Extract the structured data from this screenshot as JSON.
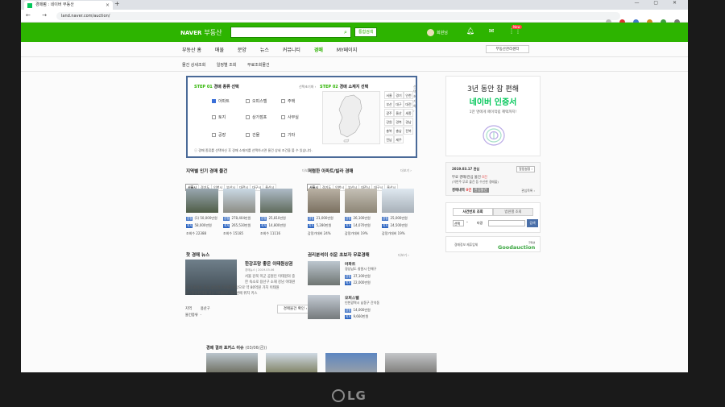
{
  "browser": {
    "tab_title": "경매펌 : 네이버 부동산",
    "new_tab": "+",
    "url": "land.naver.com/auction/",
    "window_controls": "— ▢ ✕"
  },
  "header": {
    "logo": "NAVER",
    "service": "부동산",
    "search_button_icon": "⌕",
    "integrated_search": "통합검색",
    "user_name": "회원님",
    "mail_badge": "New"
  },
  "gnb": {
    "items": [
      "부동산 홈",
      "매물",
      "분양",
      "뉴스",
      "커뮤니티",
      "경매",
      "MY페이지"
    ],
    "right_button": "부동산관리센터"
  },
  "lnb": {
    "items": [
      "물건 상세조회",
      "일정별 조회",
      "무료조회물건"
    ]
  },
  "step1": {
    "title_num": "STEP 01",
    "title": "경매 종류 선택",
    "reset": "선택초기화 ›",
    "options": [
      {
        "label": "아파트",
        "checked": true
      },
      {
        "label": "오피스텔",
        "checked": false
      },
      {
        "label": "주택",
        "checked": false
      },
      {
        "label": "토지",
        "checked": false
      },
      {
        "label": "상가점포",
        "checked": false
      },
      {
        "label": "사무실",
        "checked": false
      },
      {
        "label": "공장",
        "checked": false
      },
      {
        "label": "건물",
        "checked": false
      },
      {
        "label": "기타",
        "checked": false
      }
    ]
  },
  "step2": {
    "title_num": "STEP 02",
    "title": "경매 소재지 선택",
    "reset": "선택초기화 ›",
    "regions": [
      "서울",
      "경기",
      "인천",
      "부산",
      "대구",
      "대전",
      "광주",
      "울산",
      "세종",
      "강원",
      "경북",
      "경남",
      "충북",
      "충남",
      "전북",
      "전남",
      "제주"
    ]
  },
  "step_note": "경매 종류를 선택하신 후 경매 소재지를 선택하시면 물건 상세 조건을 볼 수 있습니다.",
  "popular": {
    "title": "지역별 인기 경매 물건",
    "more": "더보기 ›",
    "tabs": [
      "서울시",
      "경기도",
      "인천시",
      "부산시",
      "대전시",
      "대구시",
      "울산시"
    ],
    "items": [
      {
        "p1": "(1) 50,000만원",
        "p2": "58,000만원",
        "views": "조회수 22388"
      },
      {
        "p1": "278,404만원",
        "p2": "265,530만원",
        "views": "조회수 15185"
      },
      {
        "p1": "25,810만원",
        "p2": "14,800만원",
        "views": "조회수 11116"
      }
    ]
  },
  "cheap": {
    "title": "저렴한 아파트/빌라 경매",
    "more": "더보기 ›",
    "tabs": [
      "서울시",
      "경기도",
      "인천시",
      "부산시",
      "대전시",
      "대구시",
      "울산시"
    ],
    "items": [
      {
        "p1": "21,000만원",
        "p2": "5,280만원",
        "rate": "감정가대비 24%"
      },
      {
        "p1": "26,100만원",
        "p2": "14,070만원",
        "rate": "감정가대비 19%"
      },
      {
        "p1": "25,000만원",
        "p2": "24,500만원",
        "rate": "감정가대비 19%"
      }
    ]
  },
  "news": {
    "title": "핫 경매 뉴스",
    "headline": "한강조망 좋은 이태원상권",
    "sub": "경매뉴스 | 2019.03.06",
    "body1": "서울 강북 미군 공원인 이태원의 중",
    "body2": "한 숙소로 용산구 소재 강남 이태원",
    "body3": "여기 봉리는 중심 상업권 지위를 바탕으로 약 80억원 가치 이태원",
    "body4": "로~한강진역을 잇는 이태원로 대로변에 위치 키스",
    "loc_label": "지역",
    "loc_value": "용산구",
    "type_label": "물건종류",
    "type_value": "-",
    "button": "경매물건 확인 ›"
  },
  "recommend": {
    "title": "권리분석이 쉬운 초보자 무료경매",
    "more": "더보기 ›",
    "items": [
      {
        "name": "아파트",
        "addr": "경상남도 창원시 진해구",
        "p1": "37,100만원",
        "p2": "22,000만원"
      },
      {
        "name": "오피스텔",
        "addr": "인천광역시 남동구 간석동",
        "p1": "14,000만원",
        "p2": "9,660만원"
      }
    ]
  },
  "ad": {
    "line1": "3년 동안 참 편해",
    "line2": "네이버 인증서",
    "line3": "1만 명에게 페이적립 혜택까지!"
  },
  "info": {
    "title": "2019.03.17 관심",
    "button": "알림설정 ›",
    "msg1": "무료 경매/관심 물건",
    "msg1_count": "0건",
    "msg2": "(이번주 무료 물건 등 수신한 경매물)",
    "msg3": "경매내역",
    "msg3_count": "0건",
    "msg3_badge": "관심물건",
    "more": "관심목록 ›"
  },
  "casesearch": {
    "tab1": "사건번호 조회",
    "tab2": "법원별 조회",
    "select": "선택",
    "dash": "-",
    "label": "타경",
    "go": "검색"
  },
  "partner": {
    "label": "경매정보 제휴업체",
    "name": "Goodauction",
    "name_small": "굿옥션"
  },
  "focus": {
    "title": "경매 결과 포커스 이슈",
    "date": "(03/06(금))"
  },
  "bezel": {
    "brand": "LG"
  }
}
